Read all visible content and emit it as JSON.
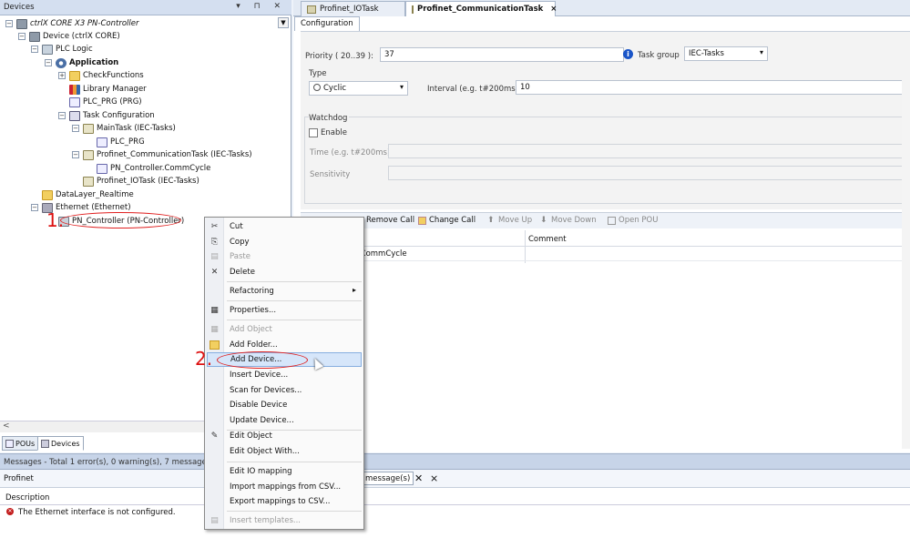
{
  "devices_panel": {
    "title": "Devices",
    "tree": [
      {
        "label": "ctrlX CORE X3 PN-Controller",
        "icon": "device-icon"
      },
      {
        "label": "Device (ctrlX CORE)",
        "icon": "device-icon"
      },
      {
        "label": "PLC Logic",
        "icon": "plc-icon"
      },
      {
        "label": "Application",
        "icon": "gear-icon"
      },
      {
        "label": "CheckFunctions",
        "icon": "folder-icon"
      },
      {
        "label": "Library Manager",
        "icon": "library-icon"
      },
      {
        "label": "PLC_PRG (PRG)",
        "icon": "program-icon"
      },
      {
        "label": "Task Configuration",
        "icon": "task-config-icon"
      },
      {
        "label": "MainTask (IEC-Tasks)",
        "icon": "task-icon"
      },
      {
        "label": "PLC_PRG",
        "icon": "program-icon"
      },
      {
        "label": "Profinet_CommunicationTask (IEC-Tasks)",
        "icon": "task-icon"
      },
      {
        "label": "PN_Controller.CommCycle",
        "icon": "program-icon"
      },
      {
        "label": "Profinet_IOTask (IEC-Tasks)",
        "icon": "task-icon"
      },
      {
        "label": "DataLayer_Realtime",
        "icon": "folder-icon"
      },
      {
        "label": "Ethernet (Ethernet)",
        "icon": "ethernet-icon"
      },
      {
        "label": "PN_Controller (PN-Controller)",
        "icon": "profinet-icon"
      }
    ],
    "bottom_tabs": [
      {
        "label": "POUs"
      },
      {
        "label": "Devices"
      }
    ]
  },
  "annotations": {
    "step1": "1.",
    "step2": "2."
  },
  "editor": {
    "tabs": [
      {
        "label": "Profinet_IOTask"
      },
      {
        "label": "Profinet_CommunicationTask",
        "close": "×"
      }
    ],
    "subtab": "Configuration",
    "priority_label": "Priority ( 20..39 ):",
    "priority_value": "37",
    "task_group_label": "Task group",
    "task_group_value": "IEC-Tasks",
    "type_label": "Type",
    "type_value": "Cyclic",
    "interval_label": "Interval (e.g. t#200ms)",
    "interval_value": "10",
    "watchdog_label": "Watchdog",
    "enable_label": "Enable",
    "time_label": "Time (e.g. t#200ms)",
    "sensitivity_label": "Sensitivity",
    "call_toolbar": {
      "remove_call": "Remove Call",
      "change_call": "Change Call",
      "move_up": "Move Up",
      "move_down": "Move Down",
      "open_pou": "Open POU"
    },
    "call_table": {
      "comment_header": "Comment",
      "row1_partial": "er.CommCycle"
    }
  },
  "context_menu": {
    "items": [
      {
        "label": "Cut",
        "icon": "scissors-icon",
        "enabled": true
      },
      {
        "label": "Copy",
        "icon": "copy-icon",
        "enabled": true
      },
      {
        "label": "Paste",
        "icon": "paste-icon",
        "enabled": false
      },
      {
        "label": "Delete",
        "icon": "delete-icon",
        "enabled": true
      },
      {
        "label": "Refactoring",
        "icon": "",
        "enabled": true,
        "submenu": "▸"
      },
      {
        "label": "Properties...",
        "icon": "properties-icon",
        "enabled": true
      },
      {
        "label": "Add Object",
        "icon": "add-object-icon",
        "enabled": false
      },
      {
        "label": "Add Folder...",
        "icon": "folder-icon",
        "enabled": true
      },
      {
        "label": "Add Device...",
        "icon": "",
        "enabled": true
      },
      {
        "label": "Insert Device...",
        "icon": "",
        "enabled": true
      },
      {
        "label": "Scan for Devices...",
        "icon": "",
        "enabled": true
      },
      {
        "label": "Disable Device",
        "icon": "",
        "enabled": true
      },
      {
        "label": "Update Device...",
        "icon": "",
        "enabled": true
      },
      {
        "label": "Edit Object",
        "icon": "edit-icon",
        "enabled": true
      },
      {
        "label": "Edit Object With...",
        "icon": "",
        "enabled": true
      },
      {
        "label": "Edit IO mapping",
        "icon": "",
        "enabled": true
      },
      {
        "label": "Import mappings from CSV...",
        "icon": "",
        "enabled": true
      },
      {
        "label": "Export mappings to CSV...",
        "icon": "",
        "enabled": true
      },
      {
        "label": "Insert templates...",
        "icon": "template-icon",
        "enabled": false
      }
    ]
  },
  "messages": {
    "header": "Messages - Total 1 error(s), 0 warning(s), 7 message(s)",
    "source": "Profinet",
    "count_partial": "message(s)",
    "description_header": "Description",
    "rows": [
      {
        "text": "The Ethernet interface is not configured.",
        "severity": "error"
      }
    ]
  },
  "colors": {
    "accent": "#1a55c8",
    "annotation": "#e02020",
    "highlight": "#d6e6fa"
  }
}
